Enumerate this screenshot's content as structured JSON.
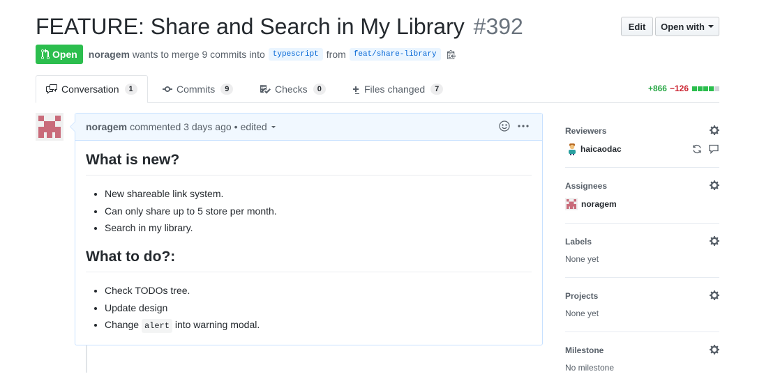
{
  "pr": {
    "title": "FEATURE: Share and Search in My Library",
    "number": "#392",
    "state": "Open",
    "author": "noragem",
    "merge_text": "wants to merge 9 commits into",
    "base_branch": "typescript",
    "from_text": "from",
    "head_branch": "feat/share-library"
  },
  "header_actions": {
    "edit_label": "Edit",
    "open_with_label": "Open with"
  },
  "tabs": [
    {
      "label": "Conversation",
      "count": "1",
      "icon": "comment-discussion-icon"
    },
    {
      "label": "Commits",
      "count": "9",
      "icon": "git-commit-icon"
    },
    {
      "label": "Checks",
      "count": "0",
      "icon": "checklist-icon"
    },
    {
      "label": "Files changed",
      "count": "7",
      "icon": "file-diff-icon"
    }
  ],
  "diffstat": {
    "additions": "+866",
    "deletions": "−126"
  },
  "comment": {
    "author": "noragem",
    "action": "commented 3 days ago",
    "edited": "edited",
    "body": {
      "heading1": "What is new?",
      "list1": [
        "New shareable link system.",
        "Can only share up to 5 store per month.",
        "Search in my library."
      ],
      "heading2": "What to do?:",
      "list2_items": [
        "Check TODOs tree.",
        "Update design"
      ],
      "list2_last_prefix": "Change",
      "list2_last_code": "alert",
      "list2_last_suffix": "into warning modal."
    }
  },
  "sidebar": {
    "reviewers": {
      "title": "Reviewers",
      "name": "haicaodac"
    },
    "assignees": {
      "title": "Assignees",
      "name": "noragem"
    },
    "labels": {
      "title": "Labels",
      "value": "None yet"
    },
    "projects": {
      "title": "Projects",
      "value": "None yet"
    },
    "milestone": {
      "title": "Milestone",
      "value": "No milestone"
    }
  },
  "colors": {
    "open_green": "#2cbe4e",
    "addition_green": "#28a745",
    "deletion_red": "#cb2431",
    "link_blue": "#0366d6",
    "avatar_pink": "#c96b7a"
  }
}
